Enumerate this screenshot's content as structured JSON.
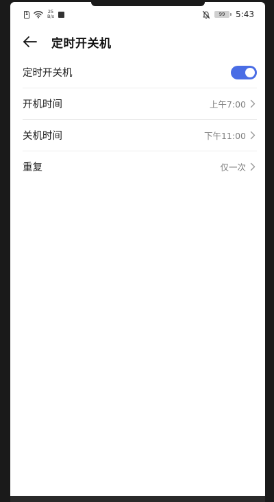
{
  "status_bar": {
    "sim_label": "1",
    "net_speed_value": "25",
    "net_speed_unit": "B/s",
    "battery": "99",
    "time": "5:43"
  },
  "header": {
    "title": "定时开关机"
  },
  "settings": [
    {
      "label": "定时开关机",
      "type": "toggle",
      "on": true
    },
    {
      "label": "开机时间",
      "value": "上午7:00"
    },
    {
      "label": "关机时间",
      "value": "下午11:00"
    },
    {
      "label": "重复",
      "value": "仅一次"
    }
  ],
  "colors": {
    "accent": "#4a6de5",
    "value_text": "#808080"
  }
}
